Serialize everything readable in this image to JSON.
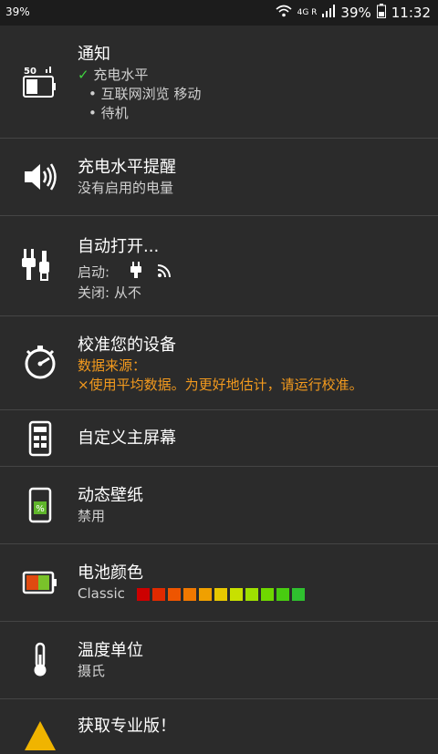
{
  "statusbar": {
    "left_battery": "39%",
    "network": "4G R",
    "battery": "39%",
    "time": "11:32"
  },
  "rows": [
    {
      "title": "通知",
      "icon_label": "50",
      "check": "✓",
      "line1": "充电水平",
      "line2": "• 互联网浏览 移动",
      "line3": "• 待机"
    },
    {
      "title": "充电水平提醒",
      "sub": "没有启用的电量"
    },
    {
      "title": "自动打开...",
      "start_label": "启动:",
      "close_label": "关闭: 从不"
    },
    {
      "title": "校准您的设备",
      "source_label": "数据来源：",
      "source_text": "×使用平均数据。为更好地估计，请运行校准。"
    },
    {
      "title": "自定义主屏幕"
    },
    {
      "title": "动态壁纸",
      "sub": "禁用"
    },
    {
      "title": "电池颜色",
      "sub": "Classic"
    },
    {
      "title": "温度单位",
      "sub": "摄氏"
    },
    {
      "title": "获取专业版！"
    }
  ],
  "battery_colors": [
    "#cc0000",
    "#e02a00",
    "#ee5500",
    "#f07800",
    "#f0a000",
    "#e8c800",
    "#c8e000",
    "#9ee000",
    "#6fd800",
    "#48cc10",
    "#2fc02f"
  ],
  "colors": {
    "background": "#2b2b2b",
    "statusbar": "#1c1c1c",
    "accent_orange": "#f39a1e",
    "check_green": "#3fd33f"
  }
}
